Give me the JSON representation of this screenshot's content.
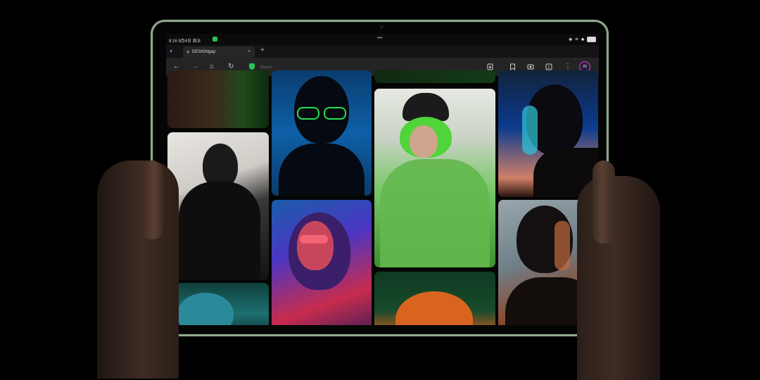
{
  "status_bar": {
    "time": "8:16 9月4日 周五",
    "right": "◉ ≋ ◆"
  },
  "tab_strip": {
    "tab_title": "DESIGNgap",
    "close_glyph": "×",
    "new_tab_glyph": "+"
  },
  "toolbar": {
    "back_glyph": "←",
    "forward_glyph": "→",
    "home_glyph": "⌂",
    "reload_glyph": "↻",
    "address_placeholder": "Search",
    "menu_glyph": "⋮",
    "avatar_text": "AI"
  },
  "colors": {
    "bezel": "#8fa88c",
    "accent_green": "#23c552",
    "avatar_ring": "#d046c6"
  },
  "gallery": {
    "tile_count": 10
  }
}
